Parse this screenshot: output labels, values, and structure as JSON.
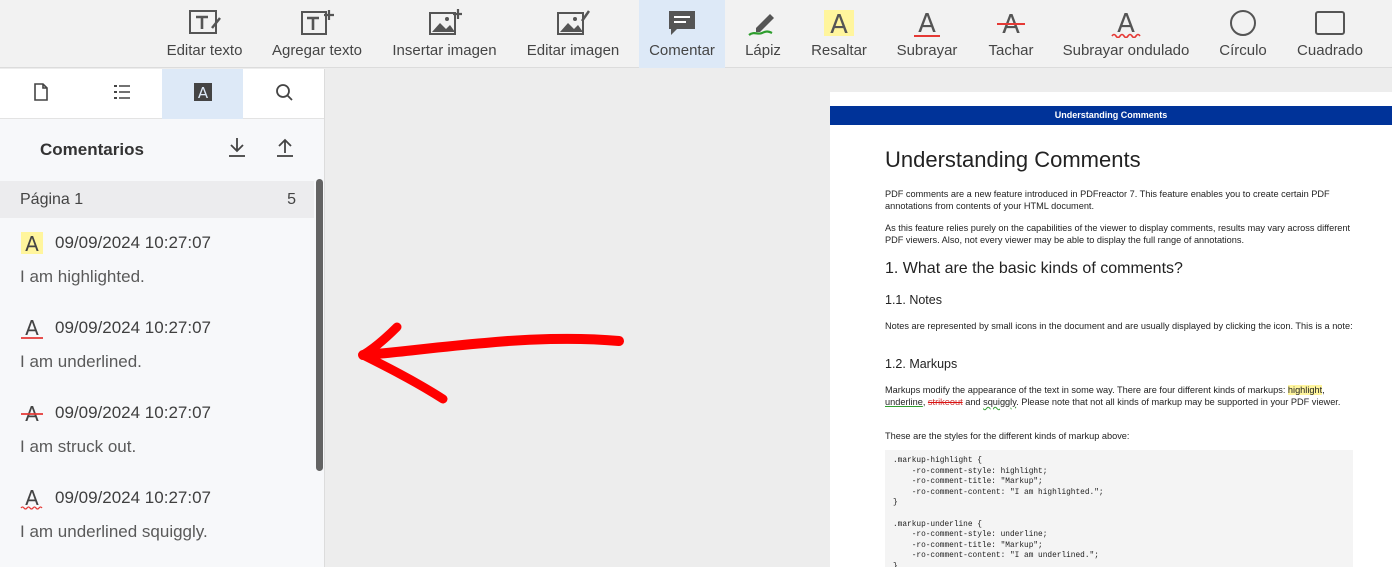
{
  "toolbar": {
    "tools": [
      {
        "id": "edit-text",
        "label": "Editar texto"
      },
      {
        "id": "add-text",
        "label": "Agregar texto"
      },
      {
        "id": "insert-image",
        "label": "Insertar imagen"
      },
      {
        "id": "edit-image",
        "label": "Editar imagen"
      },
      {
        "id": "comment",
        "label": "Comentar",
        "active": true
      },
      {
        "id": "pencil",
        "label": "Lápiz"
      },
      {
        "id": "highlight",
        "label": "Resaltar"
      },
      {
        "id": "underline",
        "label": "Subrayar"
      },
      {
        "id": "strikeout",
        "label": "Tachar"
      },
      {
        "id": "squiggly",
        "label": "Subrayar ondulado"
      },
      {
        "id": "circle",
        "label": "Círculo"
      },
      {
        "id": "square",
        "label": "Cuadrado"
      }
    ],
    "icon_glyph": "A"
  },
  "sidebar": {
    "tabs": [
      {
        "id": "pages",
        "icon": "document-icon"
      },
      {
        "id": "outline",
        "icon": "list-icon"
      },
      {
        "id": "annotations",
        "icon": "annotation-icon",
        "active": true
      },
      {
        "id": "search",
        "icon": "search-icon"
      }
    ],
    "comments_title": "Comentarios",
    "page_group": {
      "label": "Página 1",
      "count": "5"
    },
    "comments": [
      {
        "type": "highlight",
        "glyph": "A",
        "date": "09/09/2024 10:27:07",
        "text": "I am highlighted."
      },
      {
        "type": "underline",
        "glyph": "A",
        "date": "09/09/2024 10:27:07",
        "text": "I am underlined."
      },
      {
        "type": "strikeout",
        "glyph": "A",
        "date": "09/09/2024 10:27:07",
        "text": "I am struck out."
      },
      {
        "type": "squiggly",
        "glyph": "A",
        "date": "09/09/2024 10:27:07",
        "text": "I am underlined squiggly."
      }
    ]
  },
  "pdf": {
    "header": "Understanding Comments",
    "title": "Understanding Comments",
    "p1": "PDF comments are a new feature introduced in PDFreactor 7. This feature enables you to create certain PDF annotations from contents of your HTML document.",
    "p2": "As this feature relies purely on the capabilities of the viewer to display comments, results may vary across different PDF viewers. Also, not every viewer may be able to display the full range of annotations.",
    "h1": "1. What are the basic kinds of comments?",
    "h2_notes": "1.1. Notes",
    "p_notes": "Notes are represented by small icons in the document and are usually displayed by clicking the icon. This is a note:",
    "h2_markups": "1.2. Markups",
    "p_markups_start": "Markups modify the appearance of the text in some way. There are four different kinds of markups: ",
    "mk_highlight": "highlight",
    "sep1": ", ",
    "mk_underline": "underline",
    "sep2": ", ",
    "mk_strikeout": "strikeout",
    "sep3": " and ",
    "mk_squiggly": "squiggly",
    "p_markups_end": ". Please note that not all kinds of markup may be supported in your PDF viewer.",
    "p_styles": "These are the styles for the different kinds of markup above:",
    "code": ".markup-highlight {\n    -ro-comment-style: highlight;\n    -ro-comment-title: \"Markup\";\n    -ro-comment-content: \"I am highlighted.\";\n}\n\n.markup-underline {\n    -ro-comment-style: underline;\n    -ro-comment-title: \"Markup\";\n    -ro-comment-content: \"I am underlined.\";\n}"
  },
  "colors": {
    "accent_active": "#dde9f7",
    "highlight": "#fff59d",
    "underline": "#e53935",
    "arrow": "#ff0000",
    "pdf_header": "#003399"
  }
}
